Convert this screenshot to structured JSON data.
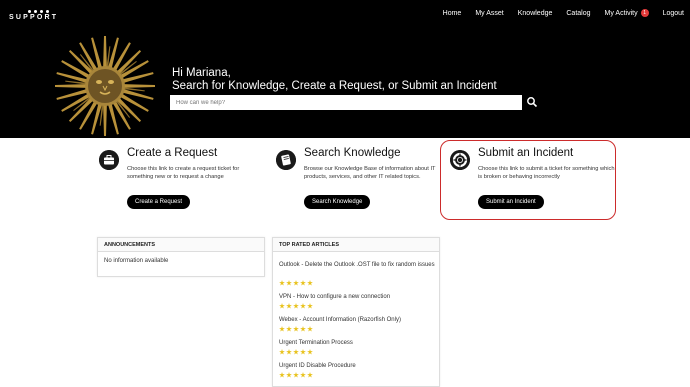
{
  "brand": {
    "name": "SUPPORT"
  },
  "nav": {
    "items": [
      {
        "label": "Home"
      },
      {
        "label": "My Asset"
      },
      {
        "label": "Knowledge"
      },
      {
        "label": "Catalog"
      },
      {
        "label": "My Activity",
        "badge": "1"
      },
      {
        "label": "Logout"
      }
    ]
  },
  "hero": {
    "greeting_line1": "Hi Mariana,",
    "greeting_line2": "Search for Knowledge, Create a Request, or Submit an Incident",
    "search_placeholder": "How can we help?"
  },
  "cards": [
    {
      "title": "Create a Request",
      "description": "Choose this link to create a request ticket for something new or to request a change",
      "button": "Create a Request",
      "icon": "briefcase-icon"
    },
    {
      "title": "Search Knowledge",
      "description": "Browse our Knowledge Base of information about IT products, services, and other IT related topics.",
      "button": "Search Knowledge",
      "icon": "book-icon"
    },
    {
      "title": "Submit an Incident",
      "description": "Choose this link to submit a ticket for something which is broken or behaving incorrectly",
      "button": "Submit an Incident",
      "icon": "lifebuoy-icon"
    }
  ],
  "announcements": {
    "header": "ANNOUNCEMENTS",
    "empty_text": "No information available"
  },
  "top_rated": {
    "header": "TOP RATED ARTICLES",
    "articles": [
      {
        "title": "Outlook - Delete the Outlook .OST file to fix random issues",
        "rating": 5
      },
      {
        "title": "VPN - How to configure a new connection",
        "rating": 5
      },
      {
        "title": "Webex - Account Information (Razorfish Only)",
        "rating": 5
      },
      {
        "title": "Urgent Termination Process",
        "rating": 5
      },
      {
        "title": "Urgent ID Disable Procedure",
        "rating": 5
      }
    ]
  },
  "colors": {
    "header_bg": "#000000",
    "highlight_border": "#cc2b2b",
    "star": "#e8c21b",
    "badge": "#e23b3b"
  }
}
